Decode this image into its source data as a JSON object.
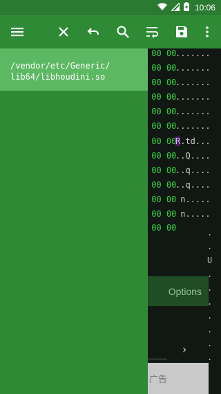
{
  "status_bar": {
    "time": "10:06",
    "wifi_icon": "wifi-icon",
    "signal_icon": "signal-icon",
    "battery_icon": "battery-icon"
  },
  "toolbar": {
    "menu_icon": "menu-icon",
    "close_icon": "close-icon",
    "undo_icon": "undo-icon",
    "search_icon": "search-icon",
    "wrap_icon": "wrap-text-icon",
    "save_icon": "save-icon",
    "more_icon": "more-vert-icon"
  },
  "drawer": {
    "file_path": "/vendor/etc/Generic/\nlib64/libhoudini.so"
  },
  "hex_rows": [
    {
      "hex": " 00 00",
      "ascii": "......."
    },
    {
      "hex": " 00 00",
      "ascii": "......."
    },
    {
      "hex": " 00 00",
      "ascii": "......."
    },
    {
      "hex": " 00 00",
      "ascii": "......."
    },
    {
      "hex": " 00 00",
      "ascii": "......."
    },
    {
      "hex": " 00 00",
      "ascii": "......."
    },
    {
      "hex": " 00 00",
      "ascii_hl": "R",
      "ascii": ".td..."
    },
    {
      "hex": " 00 00",
      "ascii": "..Q...."
    },
    {
      "hex": " 00 00",
      "ascii": "..q...."
    },
    {
      "hex": " 00 00",
      "ascii": "..q...."
    },
    {
      "hex": " 00 00",
      "ascii": " n....."
    },
    {
      "hex": " 00 00",
      "ascii": " n....."
    },
    {
      "hex": " 00 00",
      "ascii": ""
    }
  ],
  "ascii_col": ".\n.\nU\n.\n.\n.\n.\n.\n.\n.",
  "options_label": "Options",
  "chevron": "›",
  "ad_label": "广告",
  "colors": {
    "toolbar": "#2f8a36",
    "status_bar": "#2b7a31",
    "drawer": "#2f8a36",
    "drawer_header": "#5db863",
    "hex_text": "#33d13e"
  }
}
